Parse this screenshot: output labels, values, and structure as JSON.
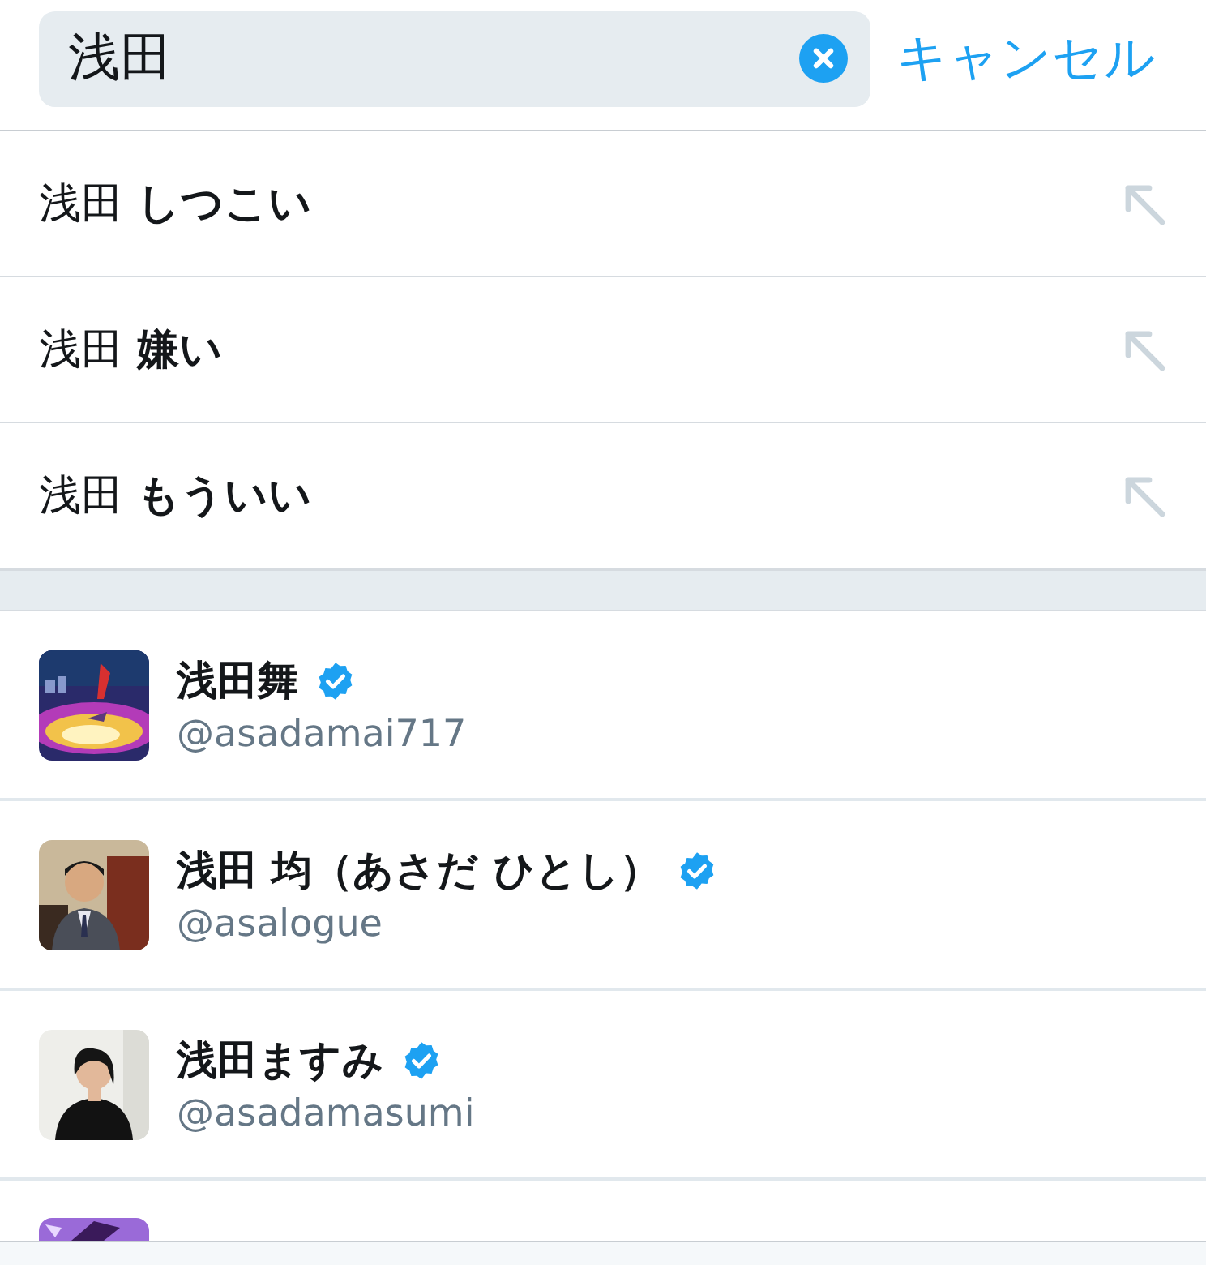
{
  "search": {
    "value": "浅田",
    "cancel": "キャンセル"
  },
  "suggestions": [
    {
      "text": "浅田 **しつこい**"
    },
    {
      "text": "浅田 **嫌い**"
    },
    {
      "text": "浅田 **もういい**"
    }
  ],
  "users": [
    {
      "name": "浅田舞",
      "handle": "@asadamai717",
      "verified": true
    },
    {
      "name": "浅田 均（あさだ ひとし）",
      "handle": "@asalogue",
      "verified": true
    },
    {
      "name": "浅田ますみ",
      "handle": "@asadamasumi",
      "verified": true
    }
  ]
}
